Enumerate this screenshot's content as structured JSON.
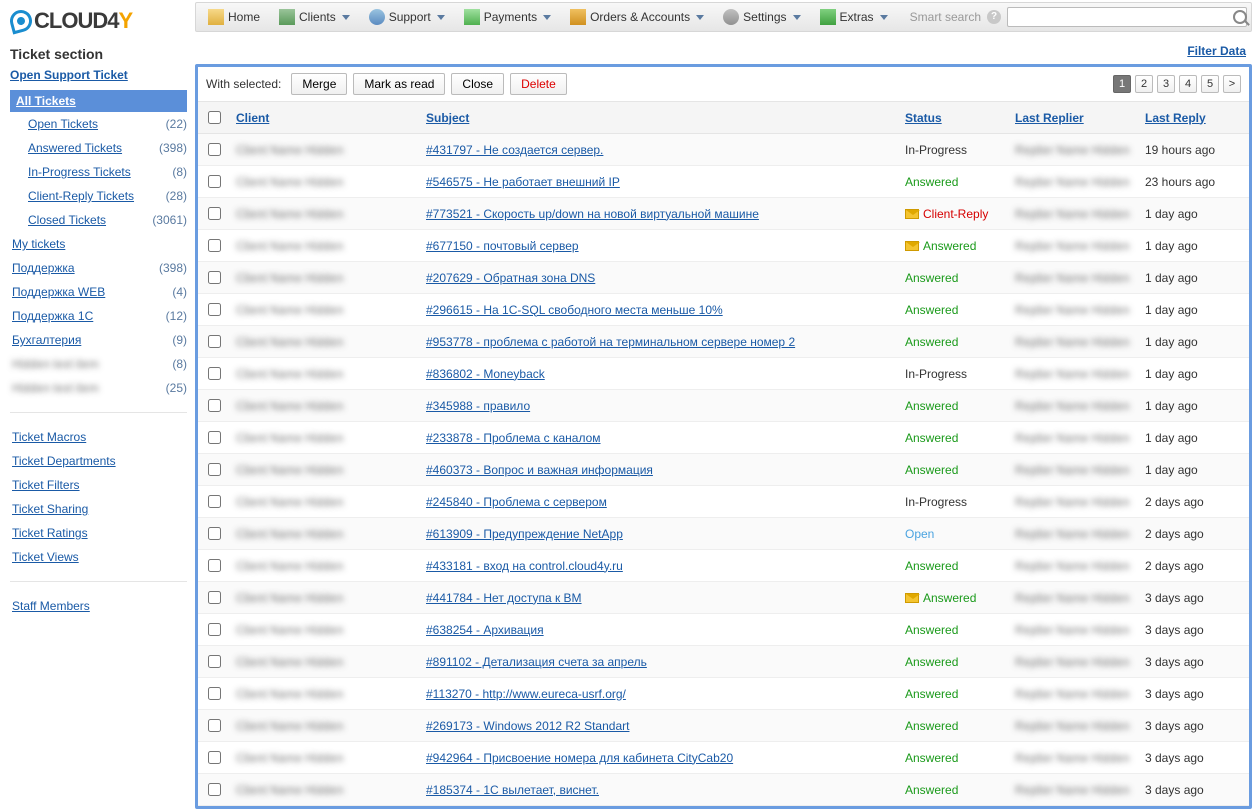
{
  "brand": "CLOUD4Y",
  "top_menu": [
    {
      "label": "Home",
      "dropdown": false
    },
    {
      "label": "Clients",
      "dropdown": true
    },
    {
      "label": "Support",
      "dropdown": true
    },
    {
      "label": "Payments",
      "dropdown": true
    },
    {
      "label": "Orders & Accounts",
      "dropdown": true
    },
    {
      "label": "Settings",
      "dropdown": true
    },
    {
      "label": "Extras",
      "dropdown": true
    }
  ],
  "smart_search_label": "Smart search",
  "search_placeholder": "",
  "sidebar": {
    "title": "Ticket section",
    "open_support": "Open Support Ticket",
    "all_tickets": "All Tickets",
    "sub": [
      {
        "label": "Open Tickets",
        "count": "(22)"
      },
      {
        "label": "Answered Tickets",
        "count": "(398)"
      },
      {
        "label": "In-Progress Tickets",
        "count": "(8)"
      },
      {
        "label": "Client-Reply Tickets",
        "count": "(28)"
      },
      {
        "label": "Closed Tickets",
        "count": "(3061)"
      }
    ],
    "groups": [
      {
        "label": "My tickets",
        "count": ""
      },
      {
        "label": "Поддержка",
        "count": "(398)"
      },
      {
        "label": "Поддержка WEB",
        "count": "(4)"
      },
      {
        "label": "Поддержка 1С",
        "count": "(12)"
      },
      {
        "label": "Бухгалтерия",
        "count": "(9)"
      },
      {
        "label": "",
        "count": "(8)",
        "blur": true
      },
      {
        "label": "",
        "count": "(25)",
        "blur": true
      }
    ],
    "extras": [
      "Ticket Macros",
      "Ticket Departments",
      "Ticket Filters",
      "Ticket Sharing",
      "Ticket Ratings",
      "Ticket Views"
    ],
    "staff": "Staff Members"
  },
  "filter_data_label": "Filter Data",
  "toolbar": {
    "with_selected": "With selected:",
    "merge": "Merge",
    "mark_read": "Mark as read",
    "close": "Close",
    "delete": "Delete"
  },
  "pager": [
    "1",
    "2",
    "3",
    "4",
    "5",
    ">"
  ],
  "pager_active": 0,
  "table": {
    "headers": {
      "client": "Client",
      "subject": "Subject",
      "status": "Status",
      "last_replier": "Last Replier",
      "last_reply": "Last Reply"
    },
    "rows": [
      {
        "subject": "#431797 - Не создается сервер.",
        "status": "In-Progress",
        "sclass": "st-ip",
        "reply": "19 hours ago"
      },
      {
        "subject": "#546575 - Не работает внешний IP",
        "status": "Answered",
        "sclass": "st-ans",
        "reply": "23 hours ago"
      },
      {
        "subject": "#773521 - Скорость up/down на новой виртуальной машине",
        "status": "Client-Reply",
        "sclass": "st-cr",
        "reply": "1 day ago",
        "env": true
      },
      {
        "subject": "#677150 - почтовый сервер",
        "status": "Answered",
        "sclass": "st-ans",
        "reply": "1 day ago",
        "env": true
      },
      {
        "subject": "#207629 - Обратная зона DNS",
        "status": "Answered",
        "sclass": "st-ans",
        "reply": "1 day ago"
      },
      {
        "subject": "#296615 - На 1С-SQL свободного места меньше 10%",
        "status": "Answered",
        "sclass": "st-ans",
        "reply": "1 day ago"
      },
      {
        "subject": "#953778 - проблема с работой на терминальном сервере номер 2",
        "status": "Answered",
        "sclass": "st-ans",
        "reply": "1 day ago"
      },
      {
        "subject": "#836802 - Moneyback",
        "status": "In-Progress",
        "sclass": "st-ip",
        "reply": "1 day ago"
      },
      {
        "subject": "#345988 - правило",
        "status": "Answered",
        "sclass": "st-ans",
        "reply": "1 day ago"
      },
      {
        "subject": "#233878 - Проблема с каналом",
        "status": "Answered",
        "sclass": "st-ans",
        "reply": "1 day ago"
      },
      {
        "subject": "#460373 - Вопрос и важная информация",
        "status": "Answered",
        "sclass": "st-ans",
        "reply": "1 day ago"
      },
      {
        "subject": "#245840 - Проблема с сервером",
        "status": "In-Progress",
        "sclass": "st-ip",
        "reply": "2 days ago"
      },
      {
        "subject": "#613909 - Предупреждение NetApp",
        "status": "Open",
        "sclass": "st-open",
        "reply": "2 days ago"
      },
      {
        "subject": "#433181 - вход на control.cloud4y.ru",
        "status": "Answered",
        "sclass": "st-ans",
        "reply": "2 days ago"
      },
      {
        "subject": "#441784 - Нет доступа к ВМ",
        "status": "Answered",
        "sclass": "st-ans",
        "reply": "3 days ago",
        "env": true
      },
      {
        "subject": "#638254 - Архивация",
        "status": "Answered",
        "sclass": "st-ans",
        "reply": "3 days ago"
      },
      {
        "subject": "#891102 - Детализация счета за апрель",
        "status": "Answered",
        "sclass": "st-ans",
        "reply": "3 days ago"
      },
      {
        "subject": "#113270 - http://www.eureca-usrf.org/",
        "status": "Answered",
        "sclass": "st-ans",
        "reply": "3 days ago"
      },
      {
        "subject": "#269173 - Windows 2012 R2 Standart",
        "status": "Answered",
        "sclass": "st-ans",
        "reply": "3 days ago"
      },
      {
        "subject": "#942964 - Присвоение номера для кабинета CityCab20",
        "status": "Answered",
        "sclass": "st-ans",
        "reply": "3 days ago"
      },
      {
        "subject": "#185374 - 1С вылетает, виснет.",
        "status": "Answered",
        "sclass": "st-ans",
        "reply": "3 days ago"
      }
    ]
  }
}
